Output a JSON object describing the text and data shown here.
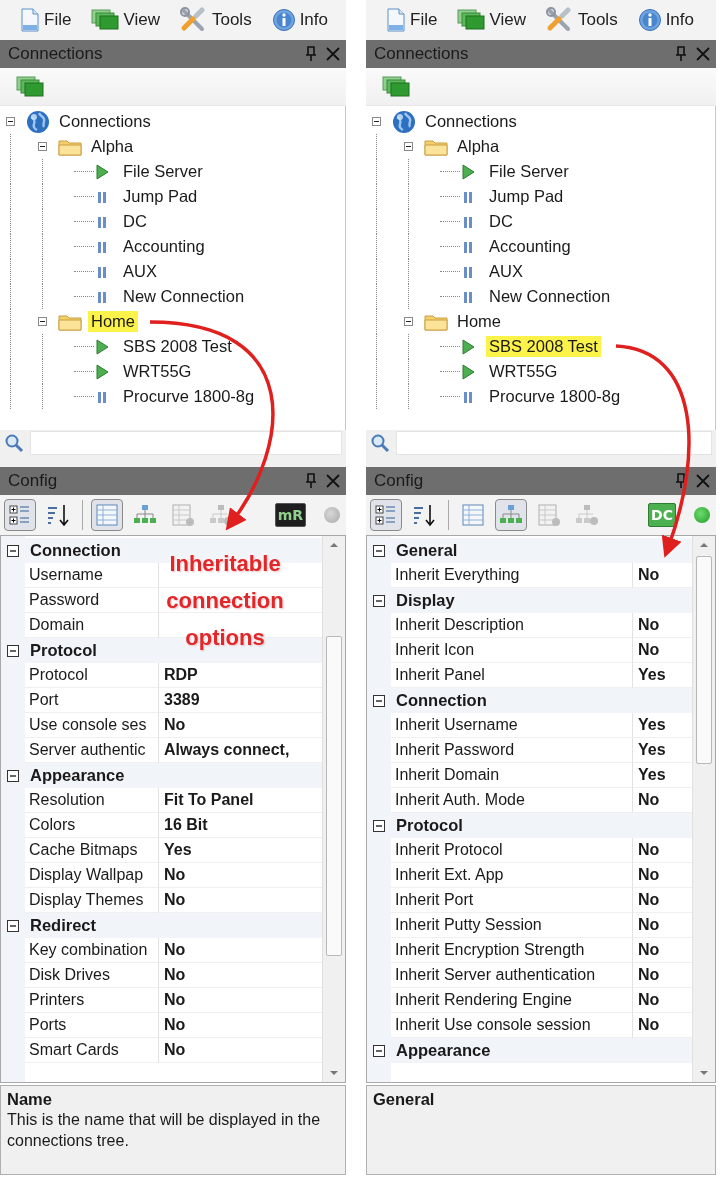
{
  "panels": [
    {
      "menu": [
        {
          "kind": "file",
          "label": "File"
        },
        {
          "kind": "view",
          "label": "View"
        },
        {
          "kind": "tools",
          "label": "Tools"
        },
        {
          "kind": "info",
          "label": "Info"
        }
      ],
      "connections": {
        "title": "Connections",
        "tree": [
          {
            "kind": "root",
            "label": "Connections",
            "expanded": true,
            "selected": false,
            "children": [
              {
                "kind": "folder",
                "label": "Alpha",
                "expanded": true,
                "selected": false,
                "children": [
                  {
                    "kind": "connection",
                    "label": "File Server",
                    "connected": true,
                    "selected": false
                  },
                  {
                    "kind": "connection",
                    "label": "Jump Pad",
                    "connected": false,
                    "selected": false
                  },
                  {
                    "kind": "connection",
                    "label": "DC",
                    "connected": false,
                    "selected": false
                  },
                  {
                    "kind": "connection",
                    "label": "Accounting",
                    "connected": false,
                    "selected": false
                  },
                  {
                    "kind": "connection",
                    "label": "AUX",
                    "connected": false,
                    "selected": false
                  },
                  {
                    "kind": "connection",
                    "label": "New Connection",
                    "connected": false,
                    "selected": false
                  }
                ]
              },
              {
                "kind": "folder",
                "label": "Home",
                "expanded": true,
                "selected": true,
                "children": [
                  {
                    "kind": "connection",
                    "label": "SBS 2008 Test",
                    "connected": true,
                    "selected": false
                  },
                  {
                    "kind": "connection",
                    "label": "WRT55G",
                    "connected": true,
                    "selected": false
                  },
                  {
                    "kind": "connection",
                    "label": "Procurve 1800-8g",
                    "connected": false,
                    "selected": false
                  }
                ]
              }
            ]
          }
        ]
      },
      "config": {
        "title": "Config",
        "toolbar": [
          {
            "kind": "categorized",
            "selected": true,
            "disabled": false
          },
          {
            "kind": "alphabetical",
            "selected": false,
            "disabled": false
          },
          {
            "kind": "properties",
            "selected": true,
            "disabled": false
          },
          {
            "kind": "inheritance",
            "selected": false,
            "disabled": false
          },
          {
            "kind": "default-properties",
            "selected": false,
            "disabled": true
          },
          {
            "kind": "default-inheritance",
            "selected": false,
            "disabled": true
          }
        ],
        "badge": {
          "kind": "mremote",
          "text": "mR"
        },
        "status": {
          "connected": false
        },
        "rows": [
          {
            "kind": "category",
            "label": "Connection",
            "expanded": true
          },
          {
            "kind": "property",
            "label": "Username"
          },
          {
            "kind": "property",
            "label": "Password"
          },
          {
            "kind": "property",
            "label": "Domain"
          },
          {
            "kind": "category",
            "label": "Protocol",
            "expanded": true
          },
          {
            "kind": "property",
            "label": "Protocol",
            "value": "RDP"
          },
          {
            "kind": "property",
            "label": "Port",
            "value": "3389"
          },
          {
            "kind": "property",
            "label": "Use console ses",
            "value": "No"
          },
          {
            "kind": "property",
            "label": "Server authentic",
            "value": "Always connect,"
          },
          {
            "kind": "category",
            "label": "Appearance",
            "expanded": true
          },
          {
            "kind": "property",
            "label": "Resolution",
            "value": "Fit To Panel"
          },
          {
            "kind": "property",
            "label": "Colors",
            "value": "16 Bit"
          },
          {
            "kind": "property",
            "label": "Cache Bitmaps",
            "value": "Yes"
          },
          {
            "kind": "property",
            "label": "Display Wallpap",
            "value": "No"
          },
          {
            "kind": "property",
            "label": "Display Themes",
            "value": "No"
          },
          {
            "kind": "category",
            "label": "Redirect",
            "expanded": true
          },
          {
            "kind": "property",
            "label": "Key combination",
            "value": "No"
          },
          {
            "kind": "property",
            "label": "Disk Drives",
            "value": "No"
          },
          {
            "kind": "property",
            "label": "Printers",
            "value": "No"
          },
          {
            "kind": "property",
            "label": "Ports",
            "value": "No"
          },
          {
            "kind": "property",
            "label": "Smart Cards",
            "value": "No"
          }
        ],
        "description": {
          "title": "Name",
          "text": "This is the name that will be displayed in the connections tree."
        }
      },
      "annotation": {
        "text": "Inheritable connection options"
      }
    },
    {
      "menu": [
        {
          "kind": "file",
          "label": "File"
        },
        {
          "kind": "view",
          "label": "View"
        },
        {
          "kind": "tools",
          "label": "Tools"
        },
        {
          "kind": "info",
          "label": "Info"
        }
      ],
      "connections": {
        "title": "Connections",
        "tree": [
          {
            "kind": "root",
            "label": "Connections",
            "expanded": true,
            "selected": false,
            "children": [
              {
                "kind": "folder",
                "label": "Alpha",
                "expanded": true,
                "selected": false,
                "children": [
                  {
                    "kind": "connection",
                    "label": "File Server",
                    "connected": true,
                    "selected": false
                  },
                  {
                    "kind": "connection",
                    "label": "Jump Pad",
                    "connected": false,
                    "selected": false
                  },
                  {
                    "kind": "connection",
                    "label": "DC",
                    "connected": false,
                    "selected": false
                  },
                  {
                    "kind": "connection",
                    "label": "Accounting",
                    "connected": false,
                    "selected": false
                  },
                  {
                    "kind": "connection",
                    "label": "AUX",
                    "connected": false,
                    "selected": false
                  },
                  {
                    "kind": "connection",
                    "label": "New Connection",
                    "connected": false,
                    "selected": false
                  }
                ]
              },
              {
                "kind": "folder",
                "label": "Home",
                "expanded": true,
                "selected": false,
                "children": [
                  {
                    "kind": "connection",
                    "label": "SBS 2008 Test",
                    "connected": true,
                    "selected": true
                  },
                  {
                    "kind": "connection",
                    "label": "WRT55G",
                    "connected": true,
                    "selected": false
                  },
                  {
                    "kind": "connection",
                    "label": "Procurve 1800-8g",
                    "connected": false,
                    "selected": false
                  }
                ]
              }
            ]
          }
        ]
      },
      "config": {
        "title": "Config",
        "toolbar": [
          {
            "kind": "categorized",
            "selected": true,
            "disabled": false
          },
          {
            "kind": "alphabetical",
            "selected": false,
            "disabled": false
          },
          {
            "kind": "properties",
            "selected": false,
            "disabled": false
          },
          {
            "kind": "inheritance",
            "selected": true,
            "disabled": false
          },
          {
            "kind": "default-properties",
            "selected": false,
            "disabled": true
          },
          {
            "kind": "default-inheritance",
            "selected": false,
            "disabled": true
          }
        ],
        "badge": {
          "kind": "rdp",
          "text": "DC"
        },
        "status": {
          "connected": true
        },
        "rows": [
          {
            "kind": "category",
            "label": "General",
            "expanded": true
          },
          {
            "kind": "property",
            "label": "Inherit Everything",
            "value": "No"
          },
          {
            "kind": "category",
            "label": "Display",
            "expanded": true
          },
          {
            "kind": "property",
            "label": "Inherit Description",
            "value": "No"
          },
          {
            "kind": "property",
            "label": "Inherit Icon",
            "value": "No"
          },
          {
            "kind": "property",
            "label": "Inherit Panel",
            "value": "Yes"
          },
          {
            "kind": "category",
            "label": "Connection",
            "expanded": true
          },
          {
            "kind": "property",
            "label": "Inherit Username",
            "value": "Yes"
          },
          {
            "kind": "property",
            "label": "Inherit Password",
            "value": "Yes"
          },
          {
            "kind": "property",
            "label": "Inherit Domain",
            "value": "Yes"
          },
          {
            "kind": "property",
            "label": "Inherit Auth. Mode",
            "value": "No"
          },
          {
            "kind": "category",
            "label": "Protocol",
            "expanded": true
          },
          {
            "kind": "property",
            "label": "Inherit Protocol",
            "value": "No"
          },
          {
            "kind": "property",
            "label": "Inherit Ext. App",
            "value": "No"
          },
          {
            "kind": "property",
            "label": "Inherit Port",
            "value": "No"
          },
          {
            "kind": "property",
            "label": "Inherit Putty Session",
            "value": "No"
          },
          {
            "kind": "property",
            "label": "Inherit Encryption Strength",
            "value": "No"
          },
          {
            "kind": "property",
            "label": "Inherit Server authentication",
            "value": "No"
          },
          {
            "kind": "property",
            "label": "Inherit Rendering Engine",
            "value": "No"
          },
          {
            "kind": "property",
            "label": "Inherit Use console session",
            "value": "No"
          },
          {
            "kind": "category",
            "label": "Appearance",
            "expanded": true
          }
        ],
        "description": {
          "title": "General"
        }
      }
    }
  ]
}
